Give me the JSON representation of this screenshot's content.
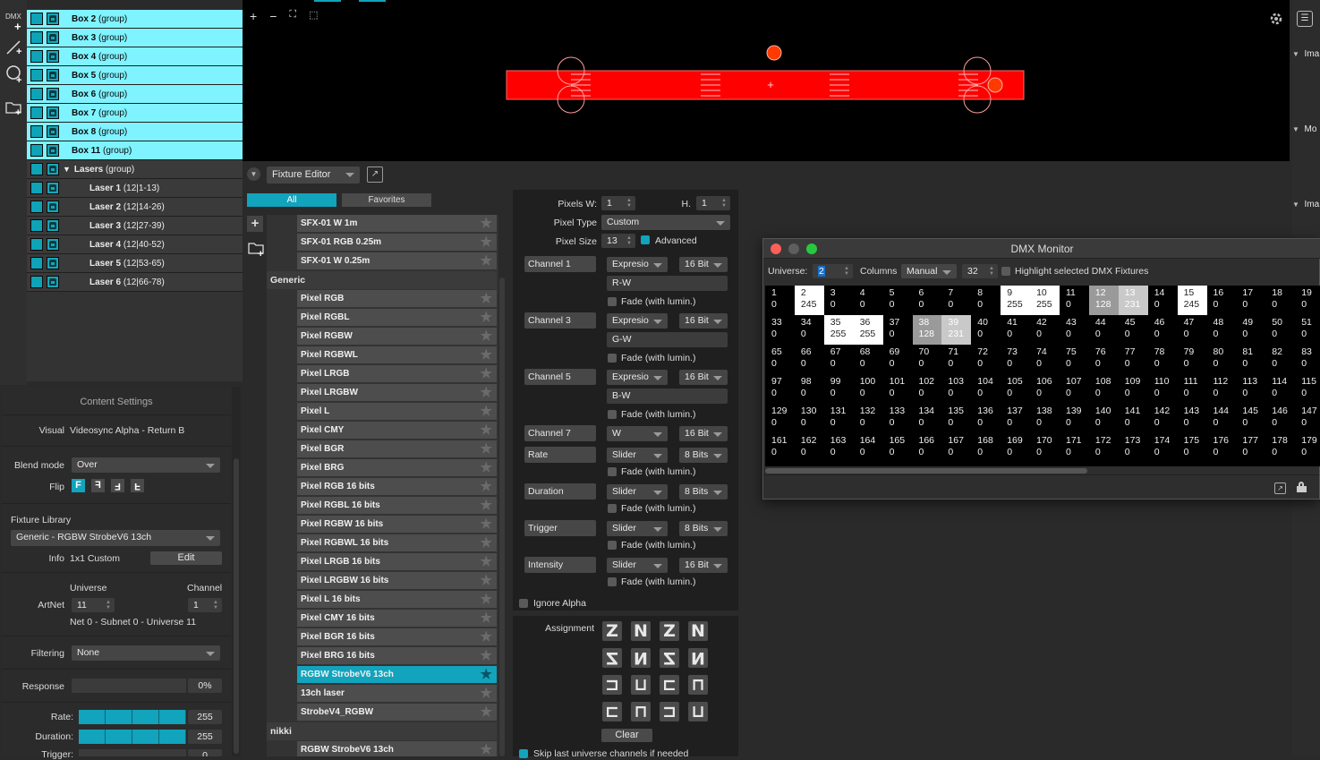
{
  "toolbar": {
    "dmx_label": "DMX"
  },
  "layers": [
    {
      "name": "Box 2",
      "suffix": "(group)",
      "selected": true
    },
    {
      "name": "Box 3",
      "suffix": "(group)",
      "selected": true
    },
    {
      "name": "Box 4",
      "suffix": "(group)",
      "selected": true
    },
    {
      "name": "Box 5",
      "suffix": "(group)",
      "selected": true
    },
    {
      "name": "Box 6",
      "suffix": "(group)",
      "selected": true
    },
    {
      "name": "Box 7",
      "suffix": "(group)",
      "selected": true
    },
    {
      "name": "Box 8",
      "suffix": "(group)",
      "selected": true
    },
    {
      "name": "Box 11",
      "suffix": "(group)",
      "selected": true
    },
    {
      "name": "Lasers",
      "suffix": "(group)",
      "selected": false
    },
    {
      "name": "Laser 1",
      "suffix": "(12|1-13)",
      "selected": false
    },
    {
      "name": "Laser 2",
      "suffix": "(12|14-26)",
      "selected": false
    },
    {
      "name": "Laser 3",
      "suffix": "(12|27-39)",
      "selected": false
    },
    {
      "name": "Laser 4",
      "suffix": "(12|40-52)",
      "selected": false
    },
    {
      "name": "Laser 5",
      "suffix": "(12|53-65)",
      "selected": false
    },
    {
      "name": "Laser 6",
      "suffix": "(12|66-78)",
      "selected": false
    }
  ],
  "content_settings": {
    "title": "Content Settings",
    "visual_label": "Visual",
    "visual_value": "Videosync Alpha - Return B",
    "blend_label": "Blend mode",
    "blend_value": "Over",
    "flip_label": "Flip",
    "flip_buttons": [
      "F",
      "F",
      "F",
      "F"
    ],
    "fixture_library_label": "Fixture Library",
    "fixture_value": "Generic - RGBW StrobeV6 13ch",
    "info_label": "Info",
    "info_value": "1x1 Custom",
    "edit_label": "Edit",
    "universe_label": "Universe",
    "channel_label": "Channel",
    "artnet_label": "ArtNet",
    "universe_value": "11",
    "channel_value": "1",
    "net_info": "Net 0 - Subnet 0 - Universe 11",
    "filtering_label": "Filtering",
    "filtering_value": "None",
    "response_label": "Response",
    "response_value": "0%",
    "rate_label": "Rate:",
    "rate_value": "255",
    "duration_label": "Duration:",
    "duration_value": "255",
    "trigger_label": "Trigger:",
    "trigger_value": "0"
  },
  "canvas_toolbar": {
    "plus": "+",
    "minus": "−"
  },
  "fixture_editor": {
    "dropdown": "Fixture Editor",
    "tab_all": "All",
    "tab_favorites": "Favorites",
    "items": [
      {
        "type": "item",
        "label": "SFX-01 W 1m"
      },
      {
        "type": "item",
        "label": "SFX-01 RGB 0.25m"
      },
      {
        "type": "item",
        "label": "SFX-01 W 0.25m"
      },
      {
        "type": "header",
        "label": "Generic"
      },
      {
        "type": "item",
        "label": "Pixel RGB"
      },
      {
        "type": "item",
        "label": "Pixel RGBL"
      },
      {
        "type": "item",
        "label": "Pixel RGBW"
      },
      {
        "type": "item",
        "label": "Pixel RGBWL"
      },
      {
        "type": "item",
        "label": "Pixel LRGB"
      },
      {
        "type": "item",
        "label": "Pixel LRGBW"
      },
      {
        "type": "item",
        "label": "Pixel L"
      },
      {
        "type": "item",
        "label": "Pixel CMY"
      },
      {
        "type": "item",
        "label": "Pixel BGR"
      },
      {
        "type": "item",
        "label": "Pixel BRG"
      },
      {
        "type": "item",
        "label": "Pixel RGB 16 bits"
      },
      {
        "type": "item",
        "label": "Pixel RGBL 16 bits"
      },
      {
        "type": "item",
        "label": "Pixel RGBW 16 bits"
      },
      {
        "type": "item",
        "label": "Pixel RGBWL 16 bits"
      },
      {
        "type": "item",
        "label": "Pixel LRGB 16 bits"
      },
      {
        "type": "item",
        "label": "Pixel LRGBW 16 bits"
      },
      {
        "type": "item",
        "label": "Pixel L 16 bits"
      },
      {
        "type": "item",
        "label": "Pixel CMY 16 bits"
      },
      {
        "type": "item",
        "label": "Pixel BGR 16 bits"
      },
      {
        "type": "item",
        "label": "Pixel BRG 16 bits"
      },
      {
        "type": "item",
        "label": "RGBW StrobeV6 13ch",
        "selected": true
      },
      {
        "type": "item",
        "label": "13ch laser"
      },
      {
        "type": "item",
        "label": "StrobeV4_RGBW"
      },
      {
        "type": "header",
        "label": "nikki"
      },
      {
        "type": "item",
        "label": "RGBW StrobeV6 13ch"
      }
    ],
    "props": {
      "pixels_w_label": "Pixels W:",
      "pixels_w": "1",
      "h_label": "H.",
      "h_value": "1",
      "pixel_type_label": "Pixel Type",
      "pixel_type": "Custom",
      "pixel_size_label": "Pixel Size",
      "pixel_size": "13",
      "advanced_label": "Advanced",
      "channels": [
        {
          "name": "Channel 1",
          "mode": "Expresio",
          "bits": "16 Bit",
          "expr": "R-W",
          "fade": "Fade (with lumin.)"
        },
        {
          "name": "Channel 3",
          "mode": "Expresio",
          "bits": "16 Bit",
          "expr": "G-W",
          "fade": "Fade (with lumin.)"
        },
        {
          "name": "Channel 5",
          "mode": "Expresio",
          "bits": "16 Bit",
          "expr": "B-W",
          "fade": "Fade (with lumin.)"
        },
        {
          "name": "Channel 7",
          "mode": "W",
          "bits": "16 Bit"
        },
        {
          "name": "Rate",
          "mode": "Slider",
          "bits": "8 Bits",
          "fade": "Fade (with lumin.)"
        },
        {
          "name": "Duration",
          "mode": "Slider",
          "bits": "8 Bits",
          "fade": "Fade (with lumin.)"
        },
        {
          "name": "Trigger",
          "mode": "Slider",
          "bits": "8 Bits",
          "fade": "Fade (with lumin.)"
        },
        {
          "name": "Intensity",
          "mode": "Slider",
          "bits": "16 Bit",
          "fade": "Fade (with lumin.)"
        }
      ],
      "fade_ch7": "Fade (with lumin.)",
      "ignore_alpha": "Ignore Alpha",
      "assignment_label": "Assignment",
      "clear_label": "Clear",
      "skip_label": "Skip last universe channels if needed"
    }
  },
  "dmx_monitor": {
    "title": "DMX Monitor",
    "universe_label": "Universe:",
    "universe_value": "2",
    "columns_label": "Columns",
    "columns_mode": "Manual",
    "columns_value": "32",
    "highlight_label": "Highlight selected DMX Fixtures",
    "cells": [
      [
        "1",
        "0",
        ""
      ],
      [
        "2",
        "245",
        "w"
      ],
      [
        "3",
        "0",
        ""
      ],
      [
        "4",
        "0",
        ""
      ],
      [
        "5",
        "0",
        ""
      ],
      [
        "6",
        "0",
        ""
      ],
      [
        "7",
        "0",
        ""
      ],
      [
        "8",
        "0",
        ""
      ],
      [
        "9",
        "255",
        "w"
      ],
      [
        "10",
        "255",
        "w"
      ],
      [
        "11",
        "0",
        ""
      ],
      [
        "12",
        "128",
        "g1"
      ],
      [
        "13",
        "231",
        "g2"
      ],
      [
        "14",
        "0",
        ""
      ],
      [
        "15",
        "245",
        "w"
      ],
      [
        "16",
        "0",
        ""
      ],
      [
        "17",
        "0",
        ""
      ],
      [
        "18",
        "0",
        ""
      ],
      [
        "19",
        "0",
        ""
      ],
      [
        "33",
        "0",
        ""
      ],
      [
        "34",
        "0",
        ""
      ],
      [
        "35",
        "255",
        "w"
      ],
      [
        "36",
        "255",
        "w"
      ],
      [
        "37",
        "0",
        ""
      ],
      [
        "38",
        "128",
        "g1"
      ],
      [
        "39",
        "231",
        "g2"
      ],
      [
        "40",
        "0",
        ""
      ],
      [
        "41",
        "0",
        ""
      ],
      [
        "42",
        "0",
        ""
      ],
      [
        "43",
        "0",
        ""
      ],
      [
        "44",
        "0",
        ""
      ],
      [
        "45",
        "0",
        ""
      ],
      [
        "46",
        "0",
        ""
      ],
      [
        "47",
        "0",
        ""
      ],
      [
        "48",
        "0",
        ""
      ],
      [
        "49",
        "0",
        ""
      ],
      [
        "50",
        "0",
        ""
      ],
      [
        "51",
        "0",
        ""
      ],
      [
        "65",
        "0",
        ""
      ],
      [
        "66",
        "0",
        ""
      ],
      [
        "67",
        "0",
        ""
      ],
      [
        "68",
        "0",
        ""
      ],
      [
        "69",
        "0",
        ""
      ],
      [
        "70",
        "0",
        ""
      ],
      [
        "71",
        "0",
        ""
      ],
      [
        "72",
        "0",
        ""
      ],
      [
        "73",
        "0",
        ""
      ],
      [
        "74",
        "0",
        ""
      ],
      [
        "75",
        "0",
        ""
      ],
      [
        "76",
        "0",
        ""
      ],
      [
        "77",
        "0",
        ""
      ],
      [
        "78",
        "0",
        ""
      ],
      [
        "79",
        "0",
        ""
      ],
      [
        "80",
        "0",
        ""
      ],
      [
        "81",
        "0",
        ""
      ],
      [
        "82",
        "0",
        ""
      ],
      [
        "83",
        "0",
        ""
      ],
      [
        "97",
        "0",
        ""
      ],
      [
        "98",
        "0",
        ""
      ],
      [
        "99",
        "0",
        ""
      ],
      [
        "100",
        "0",
        ""
      ],
      [
        "101",
        "0",
        ""
      ],
      [
        "102",
        "0",
        ""
      ],
      [
        "103",
        "0",
        ""
      ],
      [
        "104",
        "0",
        ""
      ],
      [
        "105",
        "0",
        ""
      ],
      [
        "106",
        "0",
        ""
      ],
      [
        "107",
        "0",
        ""
      ],
      [
        "108",
        "0",
        ""
      ],
      [
        "109",
        "0",
        ""
      ],
      [
        "110",
        "0",
        ""
      ],
      [
        "111",
        "0",
        ""
      ],
      [
        "112",
        "0",
        ""
      ],
      [
        "113",
        "0",
        ""
      ],
      [
        "114",
        "0",
        ""
      ],
      [
        "115",
        "0",
        ""
      ],
      [
        "129",
        "0",
        ""
      ],
      [
        "130",
        "0",
        ""
      ],
      [
        "131",
        "0",
        ""
      ],
      [
        "132",
        "0",
        ""
      ],
      [
        "133",
        "0",
        ""
      ],
      [
        "134",
        "0",
        ""
      ],
      [
        "135",
        "0",
        ""
      ],
      [
        "136",
        "0",
        ""
      ],
      [
        "137",
        "0",
        ""
      ],
      [
        "138",
        "0",
        ""
      ],
      [
        "139",
        "0",
        ""
      ],
      [
        "140",
        "0",
        ""
      ],
      [
        "141",
        "0",
        ""
      ],
      [
        "142",
        "0",
        ""
      ],
      [
        "143",
        "0",
        ""
      ],
      [
        "144",
        "0",
        ""
      ],
      [
        "145",
        "0",
        ""
      ],
      [
        "146",
        "0",
        ""
      ],
      [
        "147",
        "0",
        ""
      ],
      [
        "161",
        "0",
        ""
      ],
      [
        "162",
        "0",
        ""
      ],
      [
        "163",
        "0",
        ""
      ],
      [
        "164",
        "0",
        ""
      ],
      [
        "165",
        "0",
        ""
      ],
      [
        "166",
        "0",
        ""
      ],
      [
        "167",
        "0",
        ""
      ],
      [
        "168",
        "0",
        ""
      ],
      [
        "169",
        "0",
        ""
      ],
      [
        "170",
        "0",
        ""
      ],
      [
        "171",
        "0",
        ""
      ],
      [
        "172",
        "0",
        ""
      ],
      [
        "173",
        "0",
        ""
      ],
      [
        "174",
        "0",
        ""
      ],
      [
        "175",
        "0",
        ""
      ],
      [
        "176",
        "0",
        ""
      ],
      [
        "177",
        "0",
        ""
      ],
      [
        "178",
        "0",
        ""
      ],
      [
        "179",
        "0",
        ""
      ]
    ]
  },
  "right_panel": {
    "items": [
      "Ima",
      "Mo",
      "Ima"
    ]
  },
  "colors": {
    "accent": "#12a3bd",
    "selected_layer": "#7ff3ff",
    "fixture_red": "#ff0000"
  }
}
